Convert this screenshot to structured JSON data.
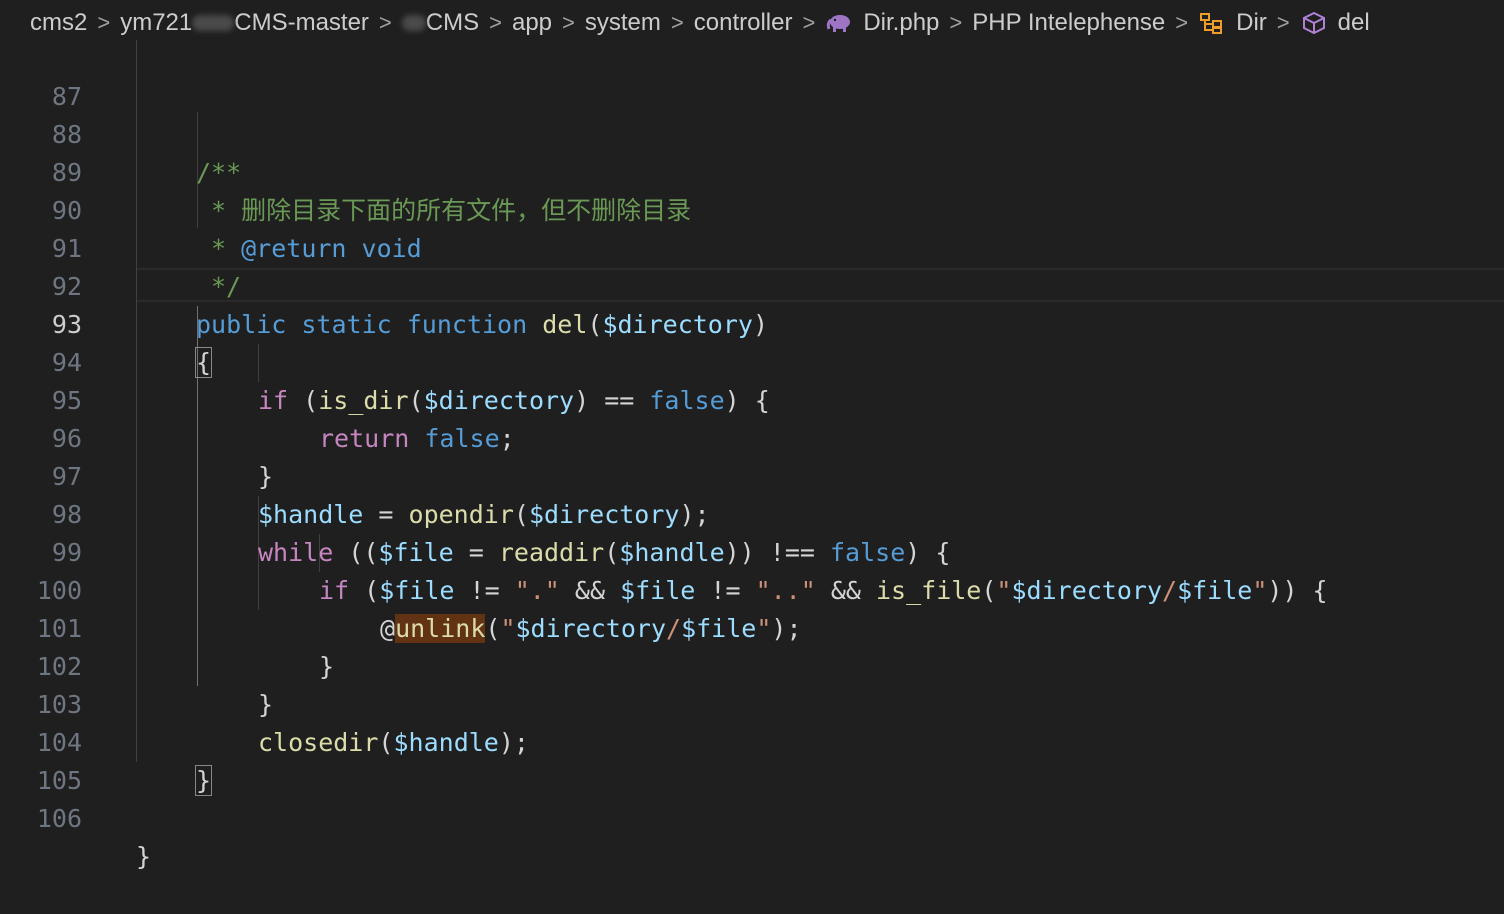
{
  "breadcrumb": {
    "items": [
      "cms2",
      "ym721",
      "CMS-master",
      "CMS",
      "app",
      "system",
      "controller",
      "Dir.php",
      "PHP Intelephense",
      "Dir",
      "del"
    ],
    "separator": ">",
    "icons": {
      "file": "php-elephant-icon",
      "class": "class-icon",
      "method": "method-cube-icon"
    }
  },
  "editor": {
    "active_line": "93",
    "lines": [
      {
        "n": "87"
      },
      {
        "n": "88",
        "t": [
          "/**"
        ]
      },
      {
        "n": "89",
        "t": [
          "* 删除目录下面的所有文件，但不删除目录"
        ]
      },
      {
        "n": "90",
        "t": [
          "* ",
          "@return",
          " void"
        ]
      },
      {
        "n": "91",
        "t": [
          "*/"
        ]
      },
      {
        "n": "92",
        "t": [
          "public",
          " ",
          "static",
          " ",
          "function",
          " ",
          "del",
          "(",
          "$directory",
          ")"
        ]
      },
      {
        "n": "93",
        "t": [
          "{"
        ]
      },
      {
        "n": "94",
        "t": [
          "if",
          " (",
          "is_dir",
          "(",
          "$directory",
          ") == ",
          "false",
          ") {"
        ]
      },
      {
        "n": "95",
        "t": [
          "return",
          " ",
          "false",
          ";"
        ]
      },
      {
        "n": "96",
        "t": [
          "}"
        ]
      },
      {
        "n": "97",
        "t": [
          "$handle",
          " = ",
          "opendir",
          "(",
          "$directory",
          ");"
        ]
      },
      {
        "n": "98",
        "t": [
          "while",
          " ((",
          "$file",
          " = ",
          "readdir",
          "(",
          "$handle",
          ")) !== ",
          "false",
          ") {"
        ]
      },
      {
        "n": "99",
        "t": [
          "if",
          " (",
          "$file",
          " != ",
          "\".\"",
          " && ",
          "$file",
          " != ",
          "\"..\"",
          " && ",
          "is_file",
          "(",
          "\"",
          "$directory",
          "/",
          "$file",
          "\"",
          ")) {"
        ]
      },
      {
        "n": "100",
        "t": [
          "@",
          "unlink",
          "(",
          "\"",
          "$directory",
          "/",
          "$file",
          "\"",
          ");"
        ]
      },
      {
        "n": "101",
        "t": [
          "}"
        ]
      },
      {
        "n": "102",
        "t": [
          "}"
        ]
      },
      {
        "n": "103",
        "t": [
          "closedir",
          "(",
          "$handle",
          ");"
        ]
      },
      {
        "n": "104",
        "t": [
          "}"
        ]
      },
      {
        "n": "105"
      },
      {
        "n": "106",
        "t": [
          "}"
        ]
      }
    ]
  },
  "colors": {
    "background": "#1f1f1f",
    "comment": "#6a9955",
    "keyword": "#569cd6",
    "control": "#c586c0",
    "function": "#dcdcaa",
    "variable": "#9cdcfe",
    "string": "#ce9178",
    "word_highlight": "#613214"
  }
}
